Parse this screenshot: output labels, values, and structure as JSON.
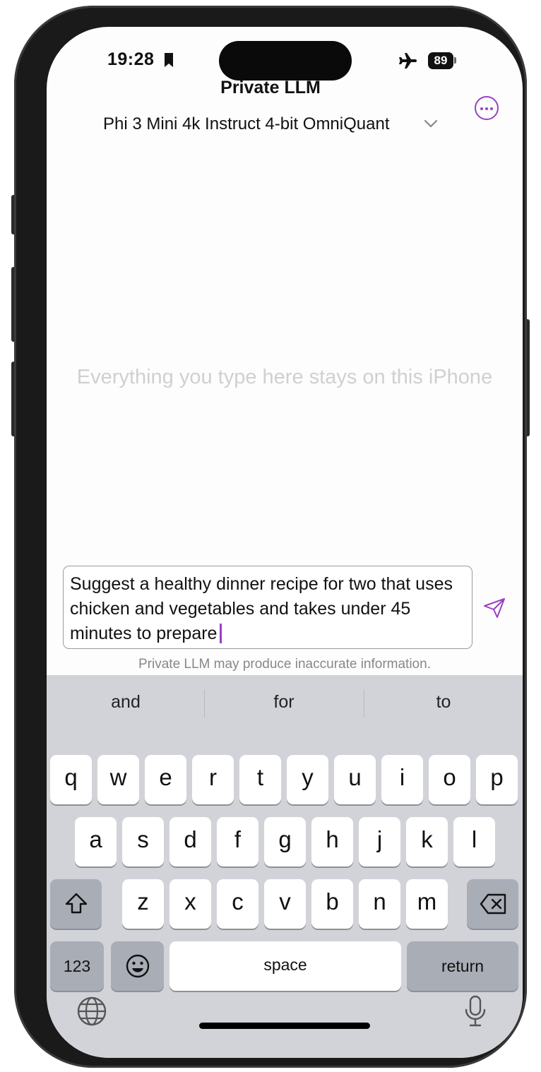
{
  "status_bar": {
    "time": "19:28",
    "battery": "89"
  },
  "header": {
    "title": "Private LLM",
    "model": "Phi 3 Mini 4k Instruct 4-bit OmniQuant",
    "more_icon": "ellipsis-circle-icon"
  },
  "empty_state": "Everything you type here stays on this iPhone",
  "composer": {
    "text": "Suggest a healthy dinner recipe for two that uses chicken and vegetables and takes under 45 minutes to prepare",
    "send_icon": "paper-plane-icon"
  },
  "disclaimer": "Private LLM may produce inaccurate information.",
  "accent_color": "#9b3fc4",
  "keyboard": {
    "suggestions": [
      "and",
      "for",
      "to"
    ],
    "row1": [
      "q",
      "w",
      "e",
      "r",
      "t",
      "y",
      "u",
      "i",
      "o",
      "p"
    ],
    "row2": [
      "a",
      "s",
      "d",
      "f",
      "g",
      "h",
      "j",
      "k",
      "l"
    ],
    "row3": [
      "z",
      "x",
      "c",
      "v",
      "b",
      "n",
      "m"
    ],
    "numbers_label": "123",
    "space_label": "space",
    "return_label": "return"
  }
}
